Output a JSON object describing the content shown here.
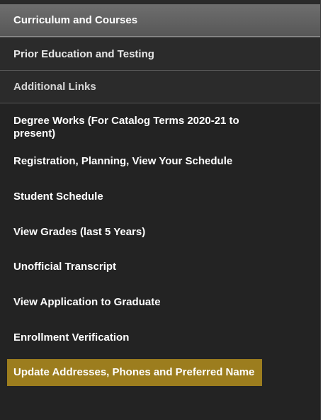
{
  "sections": {
    "header": "Curriculum and Courses",
    "prior": "Prior Education and Testing",
    "additional": "Additional Links"
  },
  "links": [
    "Degree Works (For Catalog Terms 2020-21 to present)",
    "Registration, Planning, View Your Schedule",
    "Student Schedule",
    "View Grades (last 5 Years)",
    "Unofficial Transcript",
    "View Application to Graduate",
    "Enrollment Verification",
    "Update Addresses, Phones and Preferred Name"
  ],
  "colors": {
    "panel_bg": "#232323",
    "header_bg": "#626262",
    "highlight_bg": "#9c7d1e"
  }
}
